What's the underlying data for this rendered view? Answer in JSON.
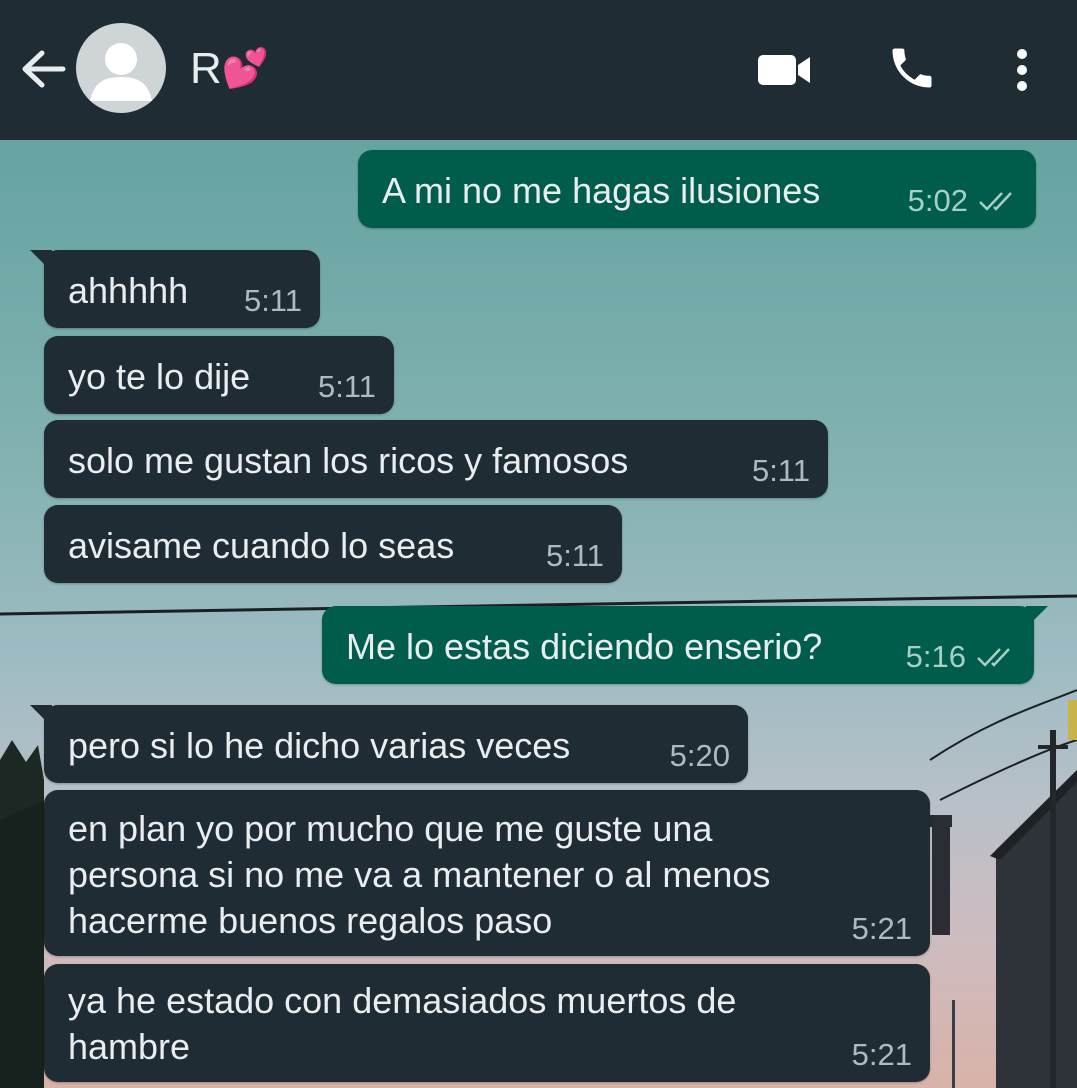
{
  "header": {
    "contact_name": "R",
    "contact_emoji": "💕",
    "icons": [
      "back-arrow-icon",
      "avatar-icon",
      "video-call-icon",
      "voice-call-icon",
      "more-options-icon"
    ]
  },
  "colors": {
    "header_bg": "#1f2c34",
    "incoming_bubble": "#1f2c34",
    "outgoing_bubble": "#005c4b",
    "text": "#e9edef",
    "timestamp": "#aebac1",
    "read_ticks": "#a8cfc6"
  },
  "messages": [
    {
      "direction": "out",
      "text": "A mi no me hagas ilusiones",
      "time": "5:02",
      "status": "read"
    },
    {
      "direction": "in",
      "text": "ahhhhh",
      "time": "5:11"
    },
    {
      "direction": "in",
      "text": "yo te lo dije",
      "time": "5:11"
    },
    {
      "direction": "in",
      "text": "solo me gustan los ricos y famosos",
      "time": "5:11"
    },
    {
      "direction": "in",
      "text": "avisame cuando lo seas",
      "time": "5:11"
    },
    {
      "direction": "out",
      "text": "Me lo estas diciendo enserio?",
      "time": "5:16",
      "status": "read"
    },
    {
      "direction": "in",
      "text": "pero si lo he dicho varias veces",
      "time": "5:20"
    },
    {
      "direction": "in",
      "text": "en plan yo por mucho que me guste una\npersona si no me va a mantener o al menos\nhacerme buenos regalos paso",
      "time": "5:21"
    },
    {
      "direction": "in",
      "text": "ya he estado con demasiados muertos de\nhambre",
      "time": "5:21"
    }
  ]
}
